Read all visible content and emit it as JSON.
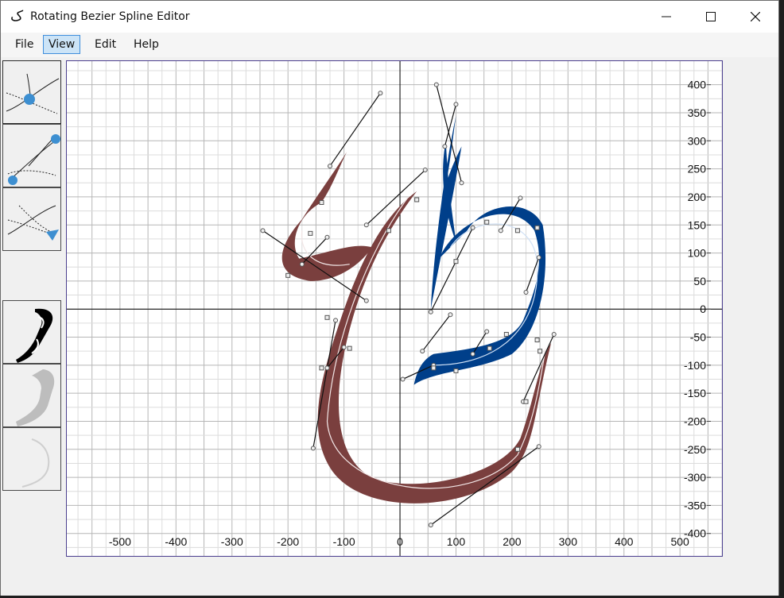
{
  "window": {
    "title": "Rotating Bezier Spline Editor",
    "icon": "ke-letter-icon",
    "controls": [
      "minimize",
      "maximize",
      "close"
    ]
  },
  "menu": {
    "items": [
      {
        "label": "File",
        "active": false
      },
      {
        "label": "View",
        "active": true
      },
      {
        "label": "Edit",
        "active": false
      },
      {
        "label": "Help",
        "active": false
      }
    ]
  },
  "tools": [
    {
      "name": "move-point-tool-icon"
    },
    {
      "name": "add-point-tool-icon"
    },
    {
      "name": "rotate-point-tool-icon"
    },
    {
      "name": "filled-shape-view-icon"
    },
    {
      "name": "shaded-shape-view-icon"
    },
    {
      "name": "outline-view-icon"
    }
  ],
  "colors": {
    "brown_stroke": "#7a3f3e",
    "blue_stroke": "#003f8a",
    "grid_major": "#b6b6b6",
    "grid_minor": "#dcdcdc",
    "axis": "#000000",
    "tool_accent": "#3d8fd1"
  },
  "plot": {
    "x_ticks": [
      -500,
      -400,
      -300,
      -200,
      -100,
      0,
      100,
      200,
      300,
      400,
      500
    ],
    "y_ticks": [
      400,
      350,
      300,
      250,
      200,
      150,
      100,
      50,
      0,
      -50,
      -100,
      -150,
      -200,
      -250,
      -300,
      -350,
      -400
    ],
    "x_range": [
      -595,
      575
    ],
    "y_range": [
      -440,
      442
    ]
  }
}
